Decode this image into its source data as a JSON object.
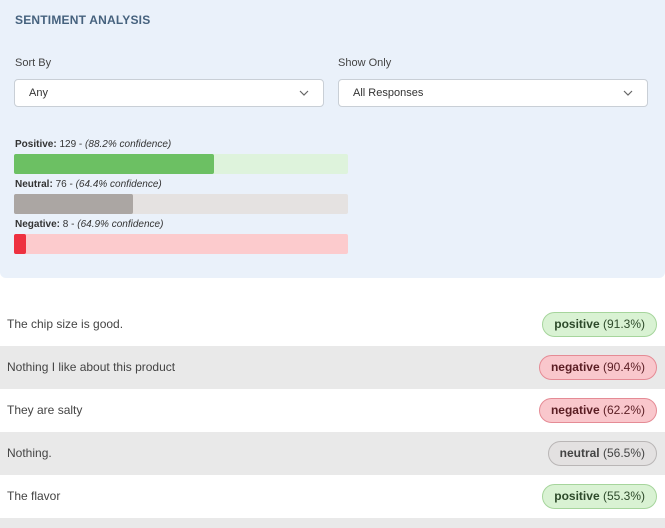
{
  "panel": {
    "title": "SENTIMENT ANALYSIS",
    "sort_by": {
      "label": "Sort By",
      "value": "Any"
    },
    "show_only": {
      "label": "Show Only",
      "value": "All Responses"
    }
  },
  "sentiments": [
    {
      "name": "Positive:",
      "count": "129",
      "confidence": "(88.2% confidence)",
      "share": 0.6,
      "track_color": "#def3dc",
      "fill_color": "#6cc063"
    },
    {
      "name": "Neutral:",
      "count": "76",
      "confidence": "(64.4% confidence)",
      "share": 0.355,
      "track_color": "#e5e2e1",
      "fill_color": "#aba6a3"
    },
    {
      "name": "Negative:",
      "count": "8",
      "confidence": "(64.9% confidence)",
      "share": 0.037,
      "track_color": "#fccbcd",
      "fill_color": "#ee3140"
    }
  ],
  "responses": [
    {
      "text": "The chip size is good.",
      "sentiment": "positive",
      "score": "(91.3%)"
    },
    {
      "text": "Nothing I like about this product",
      "sentiment": "negative",
      "score": "(90.4%)"
    },
    {
      "text": "They are salty",
      "sentiment": "negative",
      "score": "(62.2%)"
    },
    {
      "text": "Nothing.",
      "sentiment": "neutral",
      "score": "(56.5%)"
    },
    {
      "text": "The flavor",
      "sentiment": "positive",
      "score": "(55.3%)"
    }
  ]
}
